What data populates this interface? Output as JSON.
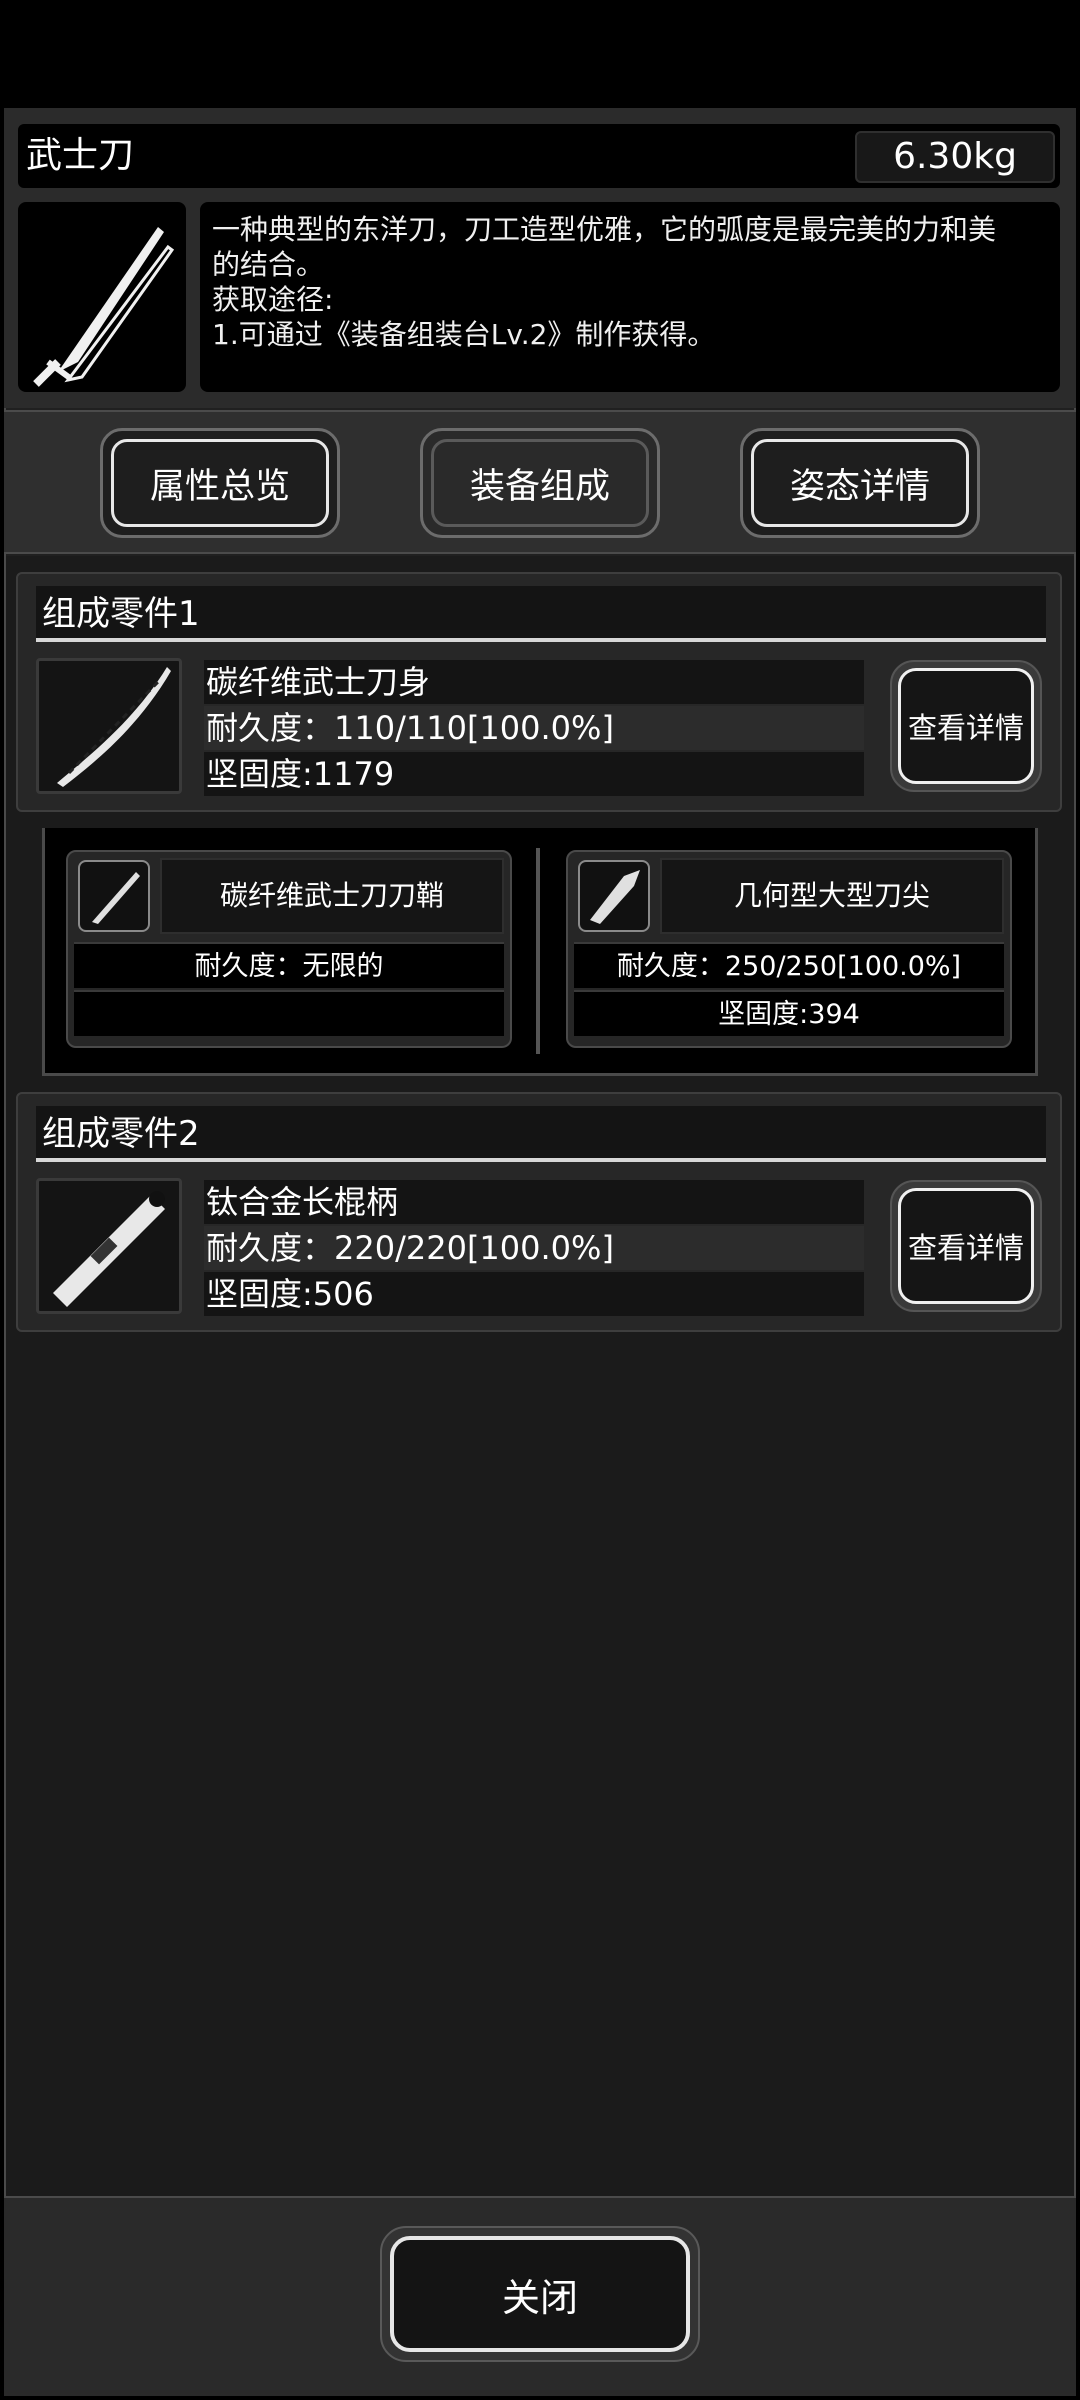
{
  "item": {
    "name": "武士刀",
    "weight": "6.30kg",
    "icon": "katana-icon",
    "description_lines": [
      "一种典型的东洋刀，刀工造型优雅，它的弧度是最完美的力和美",
      "的结合。",
      "获取途径:",
      "1.可通过《装备组装台Lv.2》制作获得。"
    ]
  },
  "tabs": [
    {
      "label": "属性总览",
      "active": false
    },
    {
      "label": "装备组成",
      "active": true
    },
    {
      "label": "姿态详情",
      "active": false
    }
  ],
  "parts": [
    {
      "title": "组成零件1",
      "name": "碳纤维武士刀身",
      "durability": "耐久度：110/110[100.0%]",
      "hardness": "坚固度:1179",
      "detail_label": "查看详情",
      "icon": "katana-blade-icon"
    },
    {
      "title": "组成零件2",
      "name": "钛合金长棍柄",
      "durability": "耐久度：220/220[100.0%]",
      "hardness": "坚固度:506",
      "detail_label": "查看详情",
      "icon": "staff-handle-icon"
    }
  ],
  "subparts": [
    {
      "name": "碳纤维武士刀刀鞘",
      "durability": "耐久度：无限的",
      "hardness": "",
      "icon": "scabbard-icon"
    },
    {
      "name": "几何型大型刀尖",
      "durability": "耐久度：250/250[100.0%]",
      "hardness": "坚固度:394",
      "icon": "blade-tip-icon"
    }
  ],
  "footer": {
    "close_label": "关闭"
  },
  "colors": {
    "background": "#000000",
    "panel": "#202020",
    "accent": "#e8e8e8"
  }
}
